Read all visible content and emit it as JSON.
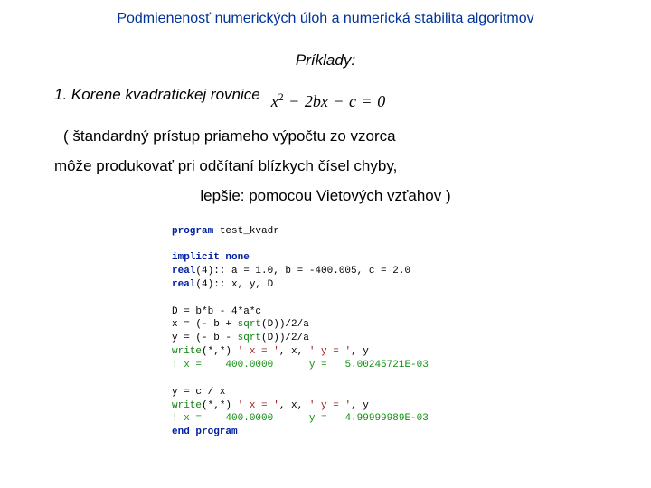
{
  "header": {
    "title": "Podmienenosť numerických úloh a numerická stabilita algoritmov"
  },
  "examples_label": "Príklady:",
  "example1": {
    "heading": "1. Korene kvadratickej rovnice",
    "formula_x2": "x",
    "formula_exp": "2",
    "formula_minus1": "−",
    "formula_2bx": "2bx",
    "formula_minus2": "−",
    "formula_c": "c",
    "formula_eq": "=",
    "formula_zero": "0",
    "line1": "( štandardný prístup priameho výpočtu zo vzorca",
    "line2": "môže produkovať pri odčítaní blízkych čísel chyby,",
    "line3": "lepšie: pomocou Vietových vzťahov )"
  },
  "code": {
    "l01a": "program",
    "l01b": " test_kvadr",
    "l02": "",
    "l03a": "implicit none",
    "l04a": "real",
    "l04b": "(4):: a = 1.0, b = -400.005, c = 2.0",
    "l05a": "real",
    "l05b": "(4):: x, y, D",
    "l06": "",
    "l07a": "D = b*b - 4*a*c",
    "l08a": "x = (- b + ",
    "l08b": "sqrt",
    "l08c": "(D))/2/a",
    "l09a": "y = (- b - ",
    "l09b": "sqrt",
    "l09c": "(D))/2/a",
    "l10a": "write",
    "l10b": "(*,*) ",
    "l10c": "' x = '",
    "l10d": ", x, ",
    "l10e": "' y = '",
    "l10f": ", y",
    "l11a": "!",
    "l11b": " x =    400.0000      y =   5.00245721E-03",
    "l12": "",
    "l13a": "y = c / x",
    "l14a": "write",
    "l14b": "(*,*) ",
    "l14c": "' x = '",
    "l14d": ", x, ",
    "l14e": "' y = '",
    "l14f": ", y",
    "l15a": "!",
    "l15b": " x =    400.0000      y =   4.99999989E-03",
    "l16a": "end program"
  }
}
